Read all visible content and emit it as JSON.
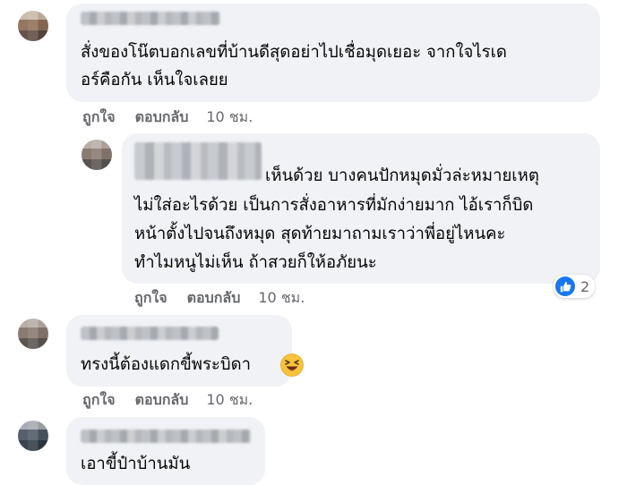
{
  "comments": [
    {
      "text_lines": [
        "สั่งของโน๊ตบอกเลขที่บ้านดีสุดอย่าไปเชื่อมุดเยอะ จากใจไรเด",
        "อร์คือกัน เห็นใจเลยย"
      ],
      "actions": {
        "like": "ถูกใจ",
        "reply": "ตอบกลับ",
        "time": "10 ชม."
      }
    },
    {
      "text_lines": [
        "เห็นด้วย บางคนปักหมุดมั่วล่ะหมายเหตุ",
        "ไม่ใส่อะไรด้วย เป็นการสั่งอาหารที่มักง่ายมาก ไอ้เราก็บิด",
        "หน้าตั้งไปจนถึงหมุด สุดท้ายมาถามเราว่าพี่อยู่ไหนคะ",
        "ทำไมหนูไม่เห็น ถ้าสวยก็ให้อภัยนะ"
      ],
      "actions": {
        "like": "ถูกใจ",
        "reply": "ตอบกลับ",
        "time": "10 ชม."
      },
      "reaction_count": "2"
    },
    {
      "text_lines": [
        "ทรงนี้ต้องแดกขี้พระบิดา"
      ],
      "actions": {
        "like": "ถูกใจ",
        "reply": "ตอบกลับ",
        "time": "10 ชม."
      },
      "emoji": "laughing-emoji"
    },
    {
      "text_lines": [
        "เอาขี้ป๋าบ้านมัน"
      ]
    }
  ],
  "colors": {
    "bubble": "#f0f2f5",
    "action_text": "#65676b",
    "like_blue": "#1877f2"
  }
}
